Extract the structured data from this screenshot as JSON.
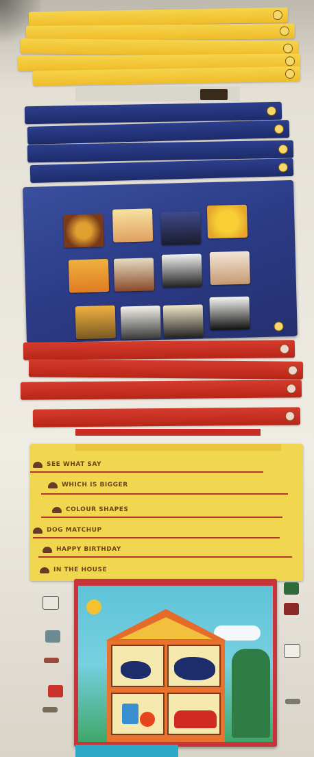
{
  "photo": {
    "subject": "stacked screenshots of a children's software menu system"
  },
  "yellow_strips": [
    {
      "label": "",
      "icon": "circle-icon"
    },
    {
      "label": "",
      "icon": "circle-icon"
    },
    {
      "label": "",
      "icon": "circle-icon"
    },
    {
      "label": "",
      "icon": "circle-icon"
    },
    {
      "label": "",
      "icon": "circle-icon"
    }
  ],
  "blue_strips": [
    {
      "label": ""
    },
    {
      "label": ""
    },
    {
      "label": ""
    },
    {
      "label": ""
    }
  ],
  "red_strips": [
    {
      "label": ""
    },
    {
      "label": ""
    },
    {
      "label": ""
    },
    {
      "label": ""
    }
  ],
  "menu": {
    "items": [
      {
        "label": "SEE WHAT SAY"
      },
      {
        "label": "WHICH IS BIGGER"
      },
      {
        "label": "COLOUR SHAPES"
      },
      {
        "label": "DOG MATCHUP"
      },
      {
        "label": "HAPPY BIRTHDAY"
      },
      {
        "label": "IN THE HOUSE"
      }
    ]
  },
  "colors": {
    "yellow": "#f2c433",
    "red": "#c2301f",
    "blue": "#2b3b86",
    "menu_text": "#6f4316"
  }
}
